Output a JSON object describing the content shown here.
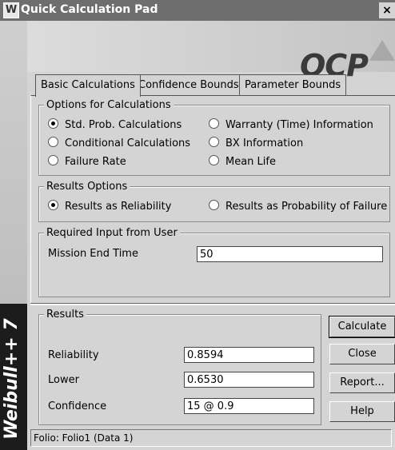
{
  "window": {
    "app_icon_glyph": "W",
    "title": "Quick Calculation Pad",
    "close_glyph": "×"
  },
  "branding": {
    "logo_text": "QCP",
    "side_logo": "Weibull++ 7"
  },
  "tabs": [
    {
      "label": "Basic Calculations",
      "active": true
    },
    {
      "label": "Confidence Bounds",
      "active": false
    },
    {
      "label": "Parameter Bounds",
      "active": false
    }
  ],
  "options_group": {
    "legend": "Options for Calculations",
    "options": [
      {
        "label": "Std. Prob. Calculations",
        "selected": true
      },
      {
        "label": "Conditional Calculations",
        "selected": false
      },
      {
        "label": "Failure Rate",
        "selected": false
      },
      {
        "label": "Warranty (Time) Information",
        "selected": false
      },
      {
        "label": "BX Information",
        "selected": false
      },
      {
        "label": "Mean Life",
        "selected": false
      }
    ]
  },
  "results_options_group": {
    "legend": "Results Options",
    "options": [
      {
        "label": "Results as Reliability",
        "selected": true
      },
      {
        "label": "Results as Probability of Failure",
        "selected": false
      }
    ]
  },
  "input_group": {
    "legend": "Required Input from User",
    "mission_end_time_label": "Mission End Time",
    "mission_end_time_value": "50"
  },
  "results_group": {
    "legend": "Results",
    "rows": [
      {
        "label": "Reliability",
        "value": "0.8594"
      },
      {
        "label": "Lower",
        "value": "0.6530"
      },
      {
        "label": "Confidence",
        "value": "15 @ 0.9"
      }
    ]
  },
  "buttons": {
    "calculate": "Calculate",
    "close": "Close",
    "report": "Report...",
    "help": "Help"
  },
  "status_bar": "Folio: Folio1 (Data 1)"
}
